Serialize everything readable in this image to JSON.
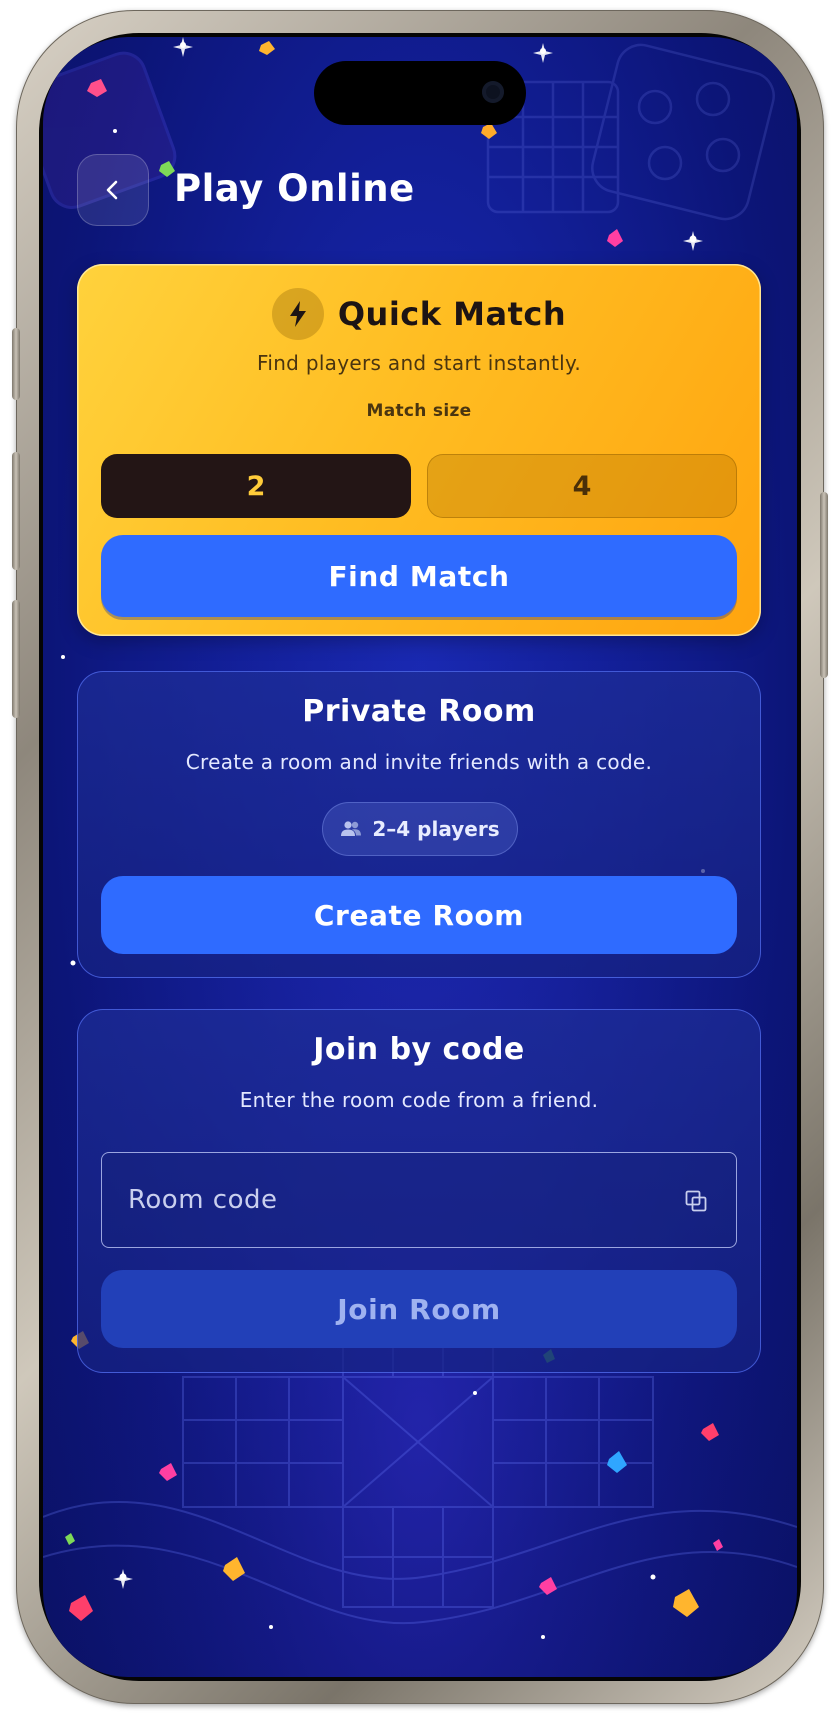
{
  "header": {
    "title": "Play Online",
    "back_icon": "chevron-left-icon"
  },
  "quick_match": {
    "title": "Quick Match",
    "icon": "lightning-bolt-icon",
    "subtitle": "Find players and start instantly.",
    "match_size_label": "Match size",
    "match_size_options": [
      "2",
      "4"
    ],
    "selected_size": "2",
    "find_button": "Find Match"
  },
  "private_room": {
    "title": "Private Room",
    "subtitle": "Create a room and invite friends with a code.",
    "players_icon": "two-people-icon",
    "players_label": "2–4 players",
    "create_button": "Create Room"
  },
  "join_by_code": {
    "title": "Join by code",
    "subtitle": "Enter the room code from a friend.",
    "input_placeholder": "Room code",
    "input_value": "",
    "paste_icon": "paste-icon",
    "join_button": "Join Room"
  },
  "colors": {
    "accent_blue": "#2f6bff",
    "quick_match_gold": "#ffbd22",
    "background_navy": "#13209b",
    "disabled_button": "#2240b8"
  }
}
